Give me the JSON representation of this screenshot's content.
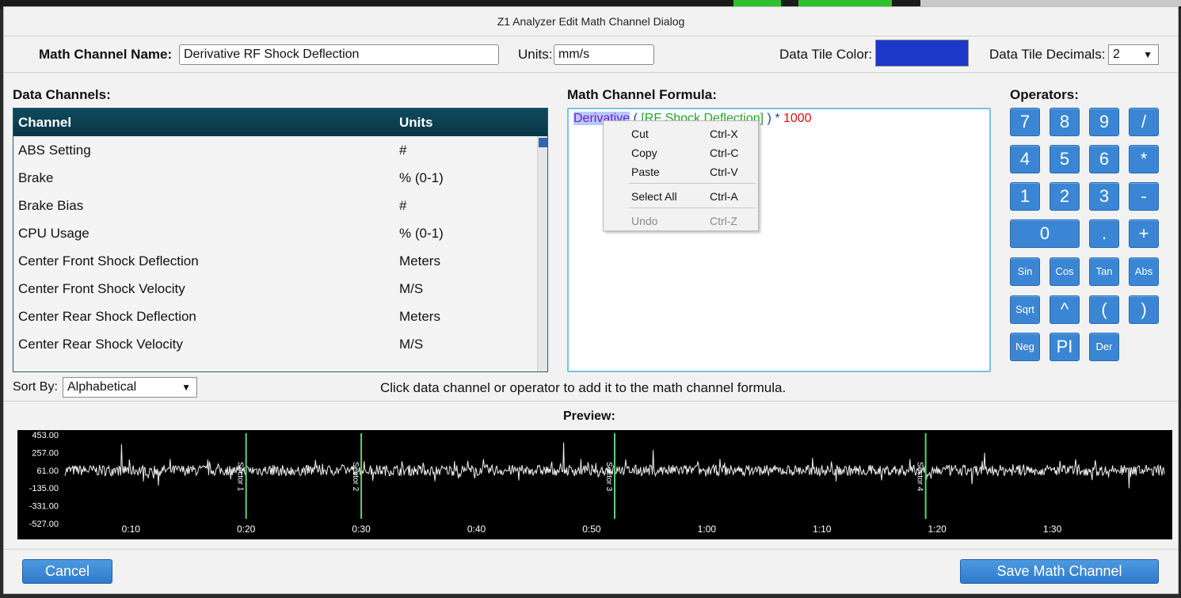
{
  "dialog": {
    "title": "Z1 Analyzer Edit Math Channel Dialog",
    "name_label": "Math Channel Name:",
    "name_value": "Derivative RF Shock Deflection",
    "units_label": "Units:",
    "units_value": "mm/s",
    "tile_color_label": "Data Tile Color:",
    "tile_color": "#1c38c8",
    "decimals_label": "Data Tile Decimals:",
    "decimals_value": "2",
    "cancel_label": "Cancel",
    "save_label": "Save Math Channel"
  },
  "data_channels": {
    "heading": "Data Channels:",
    "col_channel": "Channel",
    "col_units": "Units",
    "rows": [
      {
        "channel": "ABS Setting",
        "units": "#"
      },
      {
        "channel": "Brake",
        "units": "% (0-1)"
      },
      {
        "channel": "Brake Bias",
        "units": "#"
      },
      {
        "channel": "CPU Usage",
        "units": "% (0-1)"
      },
      {
        "channel": "Center Front Shock Deflection",
        "units": "Meters"
      },
      {
        "channel": "Center Front Shock Velocity",
        "units": "M/S"
      },
      {
        "channel": "Center Rear Shock Deflection",
        "units": "Meters"
      },
      {
        "channel": "Center Rear Shock Velocity",
        "units": "M/S"
      }
    ],
    "sort_label": "Sort By:",
    "sort_value": "Alphabetical"
  },
  "formula": {
    "heading": "Math Channel Formula:",
    "fn": "Derivative",
    "open": " ( ",
    "channel": "[RF Shock Deflection]",
    "close": " ) ",
    "op": "* ",
    "num": "1000",
    "hint": "Click data channel or operator to add it to the math channel formula."
  },
  "context_menu": [
    {
      "name": "Cut",
      "key": "Ctrl-X",
      "disabled": false
    },
    {
      "name": "Copy",
      "key": "Ctrl-C",
      "disabled": false
    },
    {
      "name": "Paste",
      "key": "Ctrl-V",
      "disabled": false
    },
    {
      "name": "Select All",
      "key": "Ctrl-A",
      "disabled": false
    },
    {
      "name": "Undo",
      "key": "Ctrl-Z",
      "disabled": true
    }
  ],
  "operators": {
    "heading": "Operators:",
    "row1": [
      "7",
      "8",
      "9",
      "/"
    ],
    "row2": [
      "4",
      "5",
      "6",
      "*"
    ],
    "row3": [
      "1",
      "2",
      "3",
      "-"
    ],
    "row4": [
      "0",
      ".",
      "+"
    ],
    "row5": [
      "Sin",
      "Cos",
      "Tan",
      "Abs"
    ],
    "row6": [
      "Sqrt",
      "^",
      "(",
      ")"
    ],
    "row7": [
      "Neg",
      "PI",
      "Der"
    ]
  },
  "preview": {
    "heading": "Preview:",
    "y_ticks": [
      "453.00",
      "257.00",
      "61.00",
      "-135.00",
      "-331.00",
      "-527.00"
    ],
    "x_ticks": [
      "0:10",
      "0:20",
      "0:30",
      "0:40",
      "0:50",
      "1:00",
      "1:10",
      "1:20",
      "1:30"
    ],
    "sectors": [
      "Sector 1",
      "Sector 2",
      "Sector 3",
      "Sector 4"
    ]
  },
  "chart_data": {
    "type": "line",
    "ylim": [
      -527,
      453
    ],
    "x_range": [
      "0:04",
      "1:40"
    ],
    "sector_times": [
      "0:20",
      "0:30",
      "0:52",
      "1:19"
    ],
    "series": [
      {
        "values": [
          61,
          120,
          -90,
          70,
          20,
          300,
          -200,
          80,
          10,
          61
        ]
      }
    ]
  }
}
